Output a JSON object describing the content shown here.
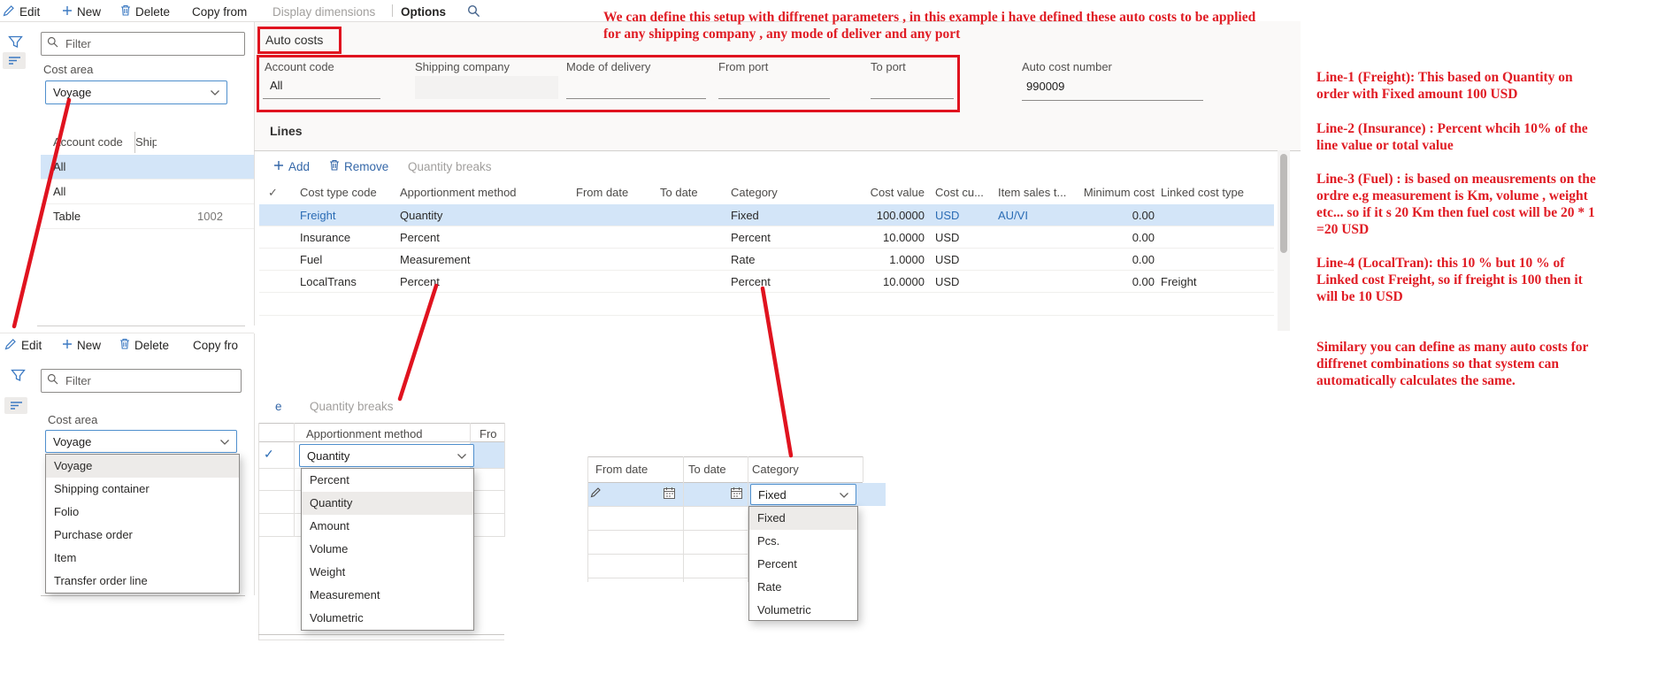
{
  "colors": {
    "annotation_red": "#e0131f",
    "accent_blue": "#2b6cb5",
    "selected_row": "#d3e5f8"
  },
  "toolbar_top": {
    "edit": "Edit",
    "new": "New",
    "delete": "Delete",
    "copy_from": "Copy from",
    "display_dimensions": "Display dimensions",
    "options": "Options"
  },
  "panel1": {
    "filter_placeholder": "Filter",
    "cost_area_label": "Cost area",
    "cost_area_value": "Voyage",
    "list": {
      "columns": [
        "Account code",
        "Ship"
      ],
      "rows": [
        {
          "account_code": "All",
          "ship": ""
        },
        {
          "account_code": "All",
          "ship": ""
        },
        {
          "account_code": "Table",
          "ship": "1002"
        }
      ]
    }
  },
  "form": {
    "tab_label": "Auto costs",
    "fields": [
      {
        "label": "Account code",
        "value": "All"
      },
      {
        "label": "Shipping company",
        "value": ""
      },
      {
        "label": "Mode of delivery",
        "value": ""
      },
      {
        "label": "From port",
        "value": ""
      },
      {
        "label": "To port",
        "value": ""
      },
      {
        "label": "Auto cost number",
        "value": "990009"
      }
    ]
  },
  "lines": {
    "title": "Lines",
    "add_label": "Add",
    "remove_label": "Remove",
    "quantity_breaks_label": "Quantity breaks",
    "columns": [
      "Cost type code",
      "Apportionment method",
      "From date",
      "To date",
      "Category",
      "Cost value",
      "Cost cu...",
      "Item sales t...",
      "Minimum cost",
      "Linked cost type"
    ],
    "rows": [
      {
        "cost_type_code": "Freight",
        "apportionment_method": "Quantity",
        "from_date": "",
        "to_date": "",
        "category": "Fixed",
        "cost_value": "100.0000",
        "cost_currency": "USD",
        "item_sales": "AU/VI",
        "minimum_cost": "0.00",
        "linked_cost_type": ""
      },
      {
        "cost_type_code": "Insurance",
        "apportionment_method": "Percent",
        "from_date": "",
        "to_date": "",
        "category": "Percent",
        "cost_value": "10.0000",
        "cost_currency": "USD",
        "item_sales": "",
        "minimum_cost": "0.00",
        "linked_cost_type": ""
      },
      {
        "cost_type_code": "Fuel",
        "apportionment_method": "Measurement",
        "from_date": "",
        "to_date": "",
        "category": "Rate",
        "cost_value": "1.0000",
        "cost_currency": "USD",
        "item_sales": "",
        "minimum_cost": "0.00",
        "linked_cost_type": ""
      },
      {
        "cost_type_code": "LocalTrans",
        "apportionment_method": "Percent",
        "from_date": "",
        "to_date": "",
        "category": "Percent",
        "cost_value": "10.0000",
        "cost_currency": "USD",
        "item_sales": "",
        "minimum_cost": "0.00",
        "linked_cost_type": "Freight"
      }
    ]
  },
  "toolbar2": {
    "edit": "Edit",
    "new": "New",
    "delete": "Delete",
    "copy_from": "Copy fro"
  },
  "panel2": {
    "filter_placeholder": "Filter",
    "cost_area_label": "Cost area",
    "cost_area_value": "Voyage",
    "dropdown_options": [
      "Voyage",
      "Shipping container",
      "Folio",
      "Purchase order",
      "Item",
      "Transfer order line"
    ]
  },
  "popup_quantity_breaks": {
    "toolbar_fragment": "e",
    "label": "Quantity breaks",
    "columns": [
      "Apportionment method",
      "Fro"
    ],
    "selected_value": "Quantity",
    "dropdown_options": [
      "Percent",
      "Quantity",
      "Amount",
      "Volume",
      "Weight",
      "Measurement",
      "Volumetric"
    ]
  },
  "popup_category": {
    "columns": [
      "From date",
      "To date",
      "Category"
    ],
    "selected_value": "Fixed",
    "dropdown_options": [
      "Fixed",
      "Pcs.",
      "Percent",
      "Rate",
      "Volumetric"
    ]
  },
  "annotations": {
    "top": "We can define this setup with diffrenet parameters , in this example i have defined these auto costs to be applied\nfor any shipping company , any mode of deliver and any port",
    "right": [
      "Line-1 (Freight): This based on Quantity on\norder with Fixed amount 100 USD",
      "Line-2 (Insurance) : Percent whcih 10% of the\nline value or total value",
      "Line-3 (Fuel) : is based on meausrements on the\nordre e.g measurement is Km, volume , weight\netc... so if it s 20 Km then fuel cost will be 20 * 1\n=20 USD",
      "Line-4 (LocalTran): this 10 % but 10 % of\nLinked cost Freight, so if freight is 100 then it\nwill be 10 USD",
      "Similary you can define as many auto costs for\ndiffrenet combinations so that system can\nautomatically calculates the same."
    ]
  }
}
